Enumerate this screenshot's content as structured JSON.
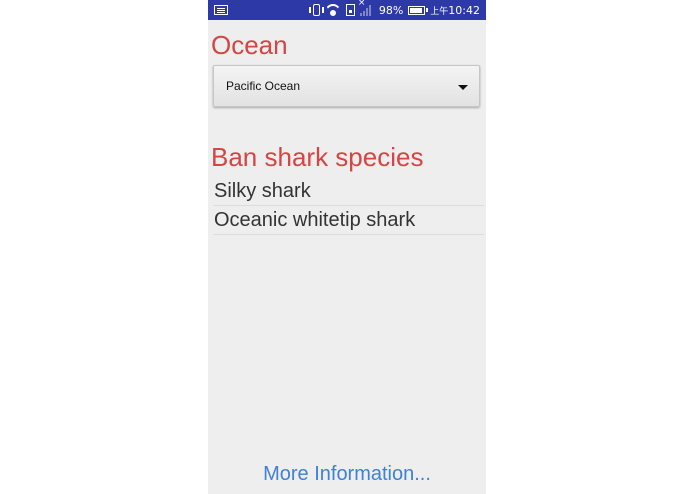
{
  "status_bar": {
    "battery_text": "98%",
    "battery_level": 0.98,
    "ampm": "上午",
    "time": "10:42",
    "signal_x": "×",
    "icons": [
      "keyboard-icon",
      "vibrate-icon",
      "wifi-icon",
      "sim-icon",
      "signal-icon",
      "battery-icon"
    ],
    "background_color": "#2d39a6"
  },
  "ocean": {
    "heading": "Ocean",
    "selected": "Pacific Ocean"
  },
  "species": {
    "heading": "Ban shark species",
    "items": [
      "Silky shark",
      "Oceanic whitetip shark"
    ]
  },
  "footer": {
    "link": "More Information..."
  },
  "colors": {
    "heading": "#d54544",
    "link": "#3f81d6",
    "background": "#eeeeee"
  }
}
